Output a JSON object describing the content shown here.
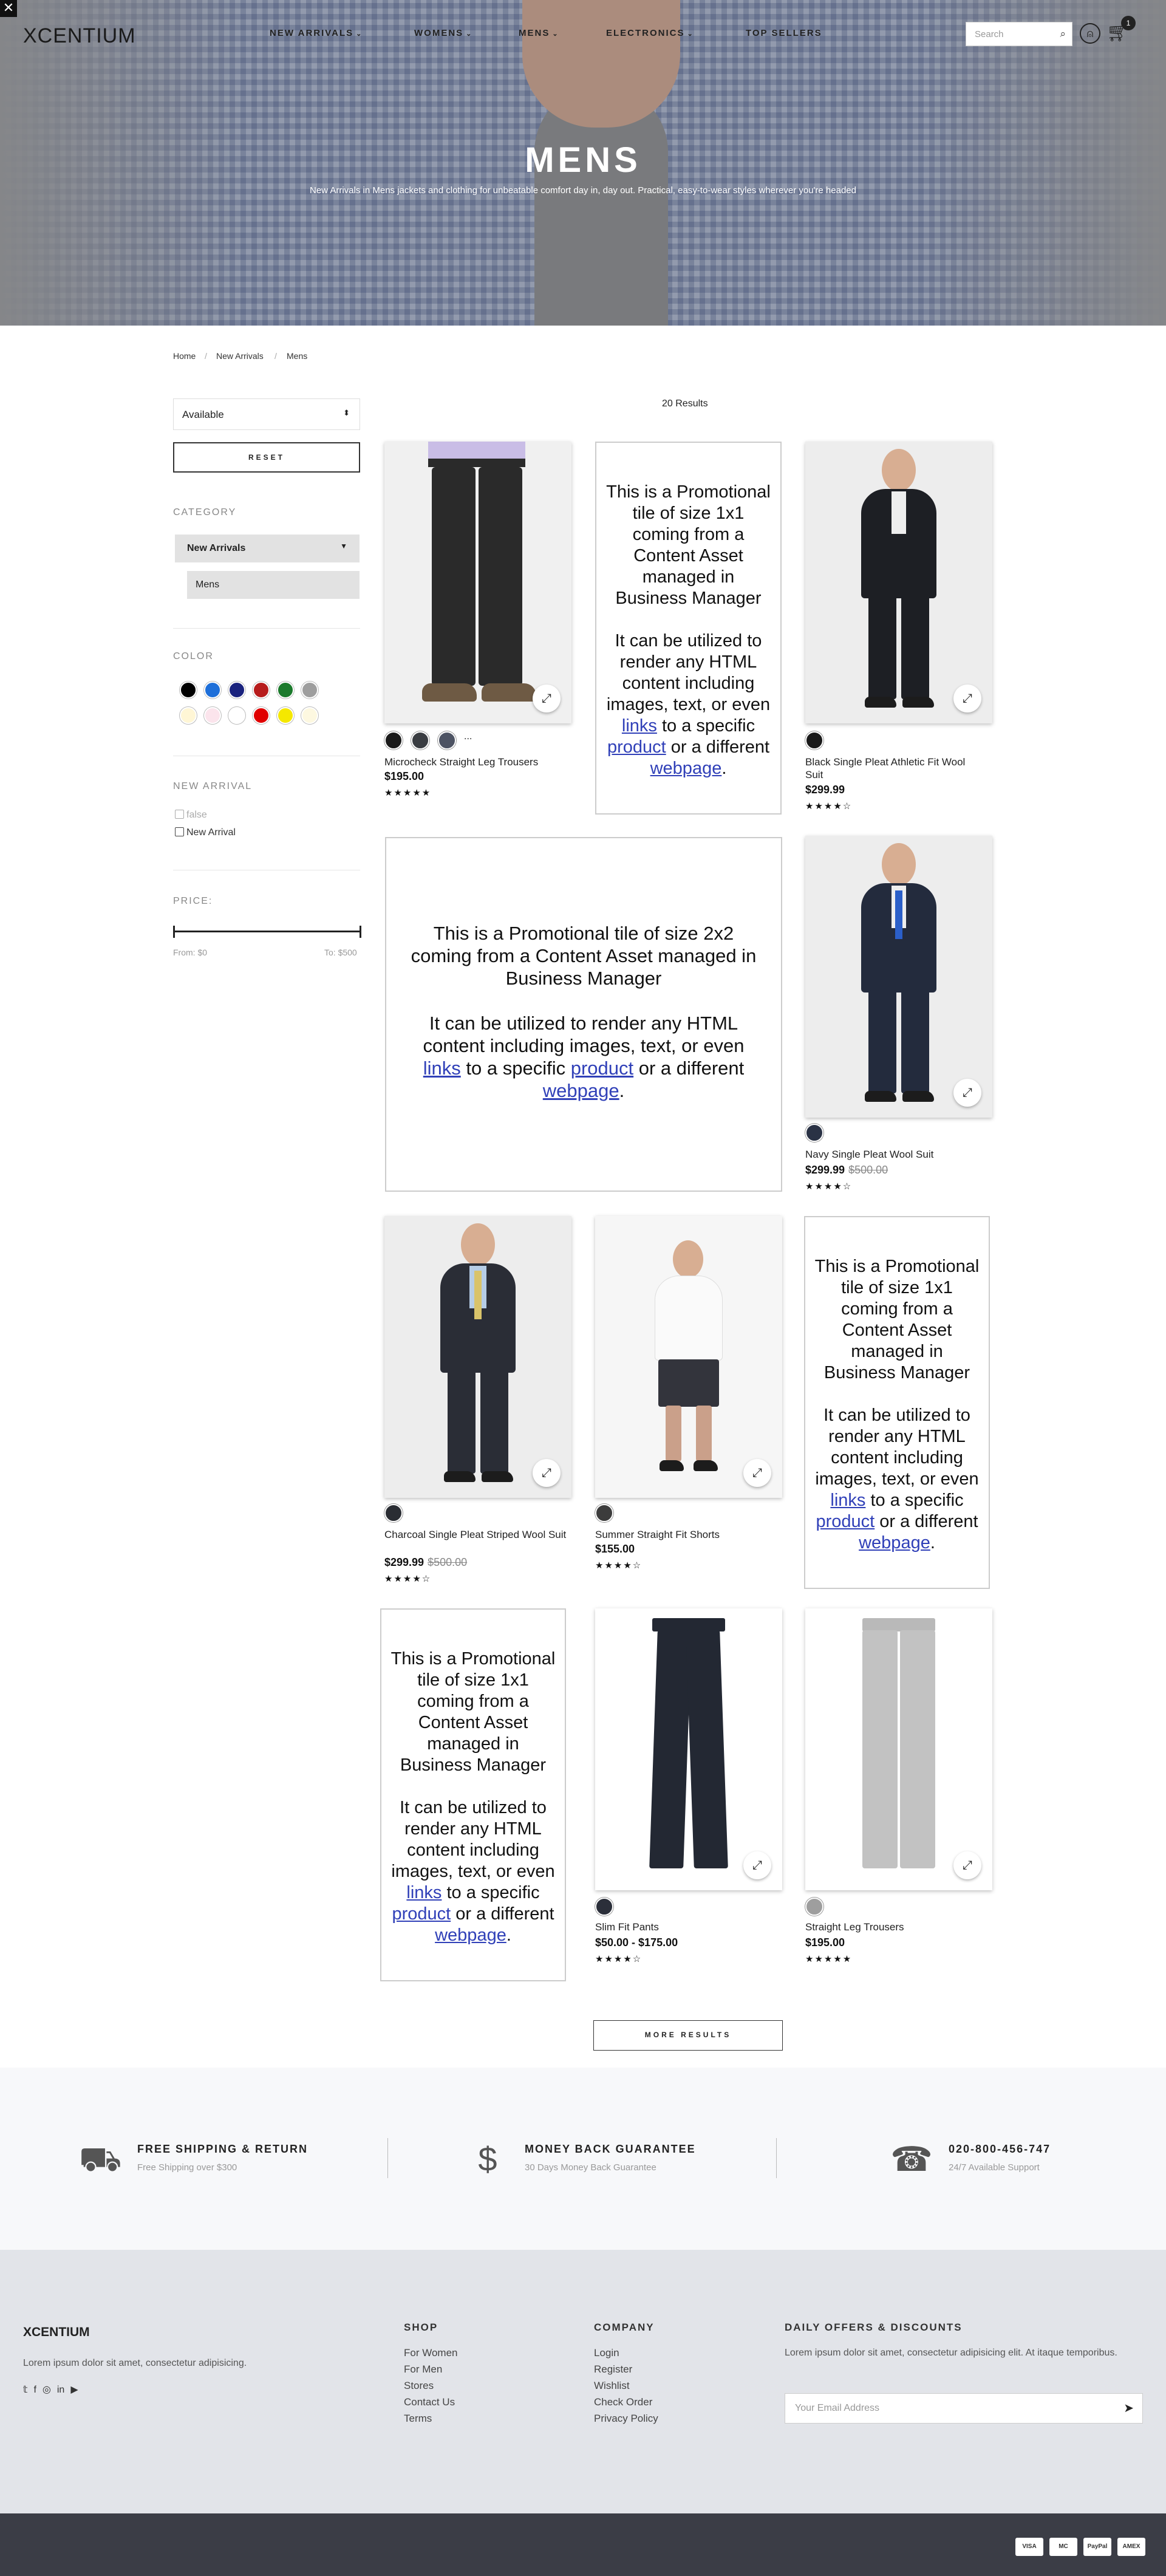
{
  "header": {
    "logo": "XCENTIUM",
    "nav": [
      "NEW ARRIVALS",
      "WOMENS",
      "MENS",
      "ELECTRONICS",
      "TOP SELLERS"
    ],
    "search_placeholder": "Search",
    "cart_count": "1"
  },
  "hero": {
    "title": "MENS",
    "subtitle": "New Arrivals in Mens jackets and clothing for unbeatable comfort day in, day out. Practical, easy-to-wear styles wherever you're headed"
  },
  "breadcrumb": [
    "Home",
    "New Arrivals",
    "Mens"
  ],
  "sidebar": {
    "sort_value": "Available",
    "reset_label": "RESET",
    "category_heading": "CATEGORY",
    "category_selected": "New Arrivals",
    "category_sub": "Mens",
    "color_heading": "COLOR",
    "colors": [
      "#000000",
      "#1e6fd9",
      "#1a237e",
      "#b71c1c",
      "#1b7a2c",
      "#9e9e9e",
      "#fff6d5",
      "#fbe4ec",
      "#ffffff",
      "#e00000",
      "#f5e800",
      "#fdf8e0"
    ],
    "new_arrival_heading": "NEW ARRIVAL",
    "new_arrival_options": [
      "false",
      "New Arrival"
    ],
    "price_heading": "PRICE:",
    "price_from": "From: $0",
    "price_to": "To: $500"
  },
  "results": {
    "count": "20 Results",
    "more_label": "MORE RESULTS"
  },
  "promo": {
    "small_line1": "This is a Promotional tile of size 1x1 coming from a Content Asset managed in Business Manager",
    "large_line1": "This is a Promotional tile of size 2x2 coming  from a Content Asset managed in Business Manager",
    "line2_prefix": "It can be utilized to render any HTML content including images, text, or even",
    "link1": "links",
    "mid1": "to a specific",
    "link2": "product",
    "mid2": "or a different",
    "link3": "webpage",
    "end": "."
  },
  "products": [
    {
      "name": "Microcheck Straight Leg Trousers",
      "price": "$195.00",
      "old_price": "",
      "rating": 4.5,
      "stars": "★★★★★",
      "swatches": [
        "#1a1a1a",
        "#3a3d42",
        "#4d5363"
      ],
      "more": "..."
    },
    {
      "name": "Black Single Pleat Athletic Fit Wool Suit",
      "price": "$299.99",
      "old_price": "",
      "rating": 4,
      "stars": "★★★★☆",
      "swatches": [
        "#1a1a1a"
      ]
    },
    {
      "name": "Navy Single Pleat Wool Suit",
      "price": "$299.99",
      "old_price": "$500.00",
      "rating": 3.5,
      "stars": "★★★★☆",
      "swatches": [
        "#2a3245"
      ]
    },
    {
      "name": "Charcoal Single Pleat Striped Wool Suit",
      "price": "$299.99",
      "old_price": "$500.00",
      "rating": 3.5,
      "stars": "★★★★☆",
      "swatches": [
        "#2a2d33"
      ]
    },
    {
      "name": "Summer Straight Fit Shorts",
      "price": "$155.00",
      "old_price": "",
      "rating": 3.5,
      "stars": "★★★★☆",
      "swatches": [
        "#3c3c3c"
      ]
    },
    {
      "name": "Slim Fit Pants",
      "price": "$50.00 - $175.00",
      "old_price": "",
      "rating": 3.5,
      "stars": "★★★★☆",
      "swatches": [
        "#2b2f3a"
      ]
    },
    {
      "name": "Straight Leg Trousers",
      "price": "$195.00",
      "old_price": "",
      "rating": 5,
      "stars": "★★★★★",
      "swatches": [
        "#9e9e9e"
      ]
    }
  ],
  "features": [
    {
      "title": "FREE SHIPPING & RETURN",
      "subtitle": "Free Shipping over $300",
      "icon": "delivery-truck-icon"
    },
    {
      "title": "MONEY BACK GUARANTEE",
      "subtitle": "30 Days Money Back Guarantee",
      "icon": "money-back-icon"
    },
    {
      "title": "020-800-456-747",
      "subtitle": "24/7 Available Support",
      "icon": "support-agent-icon"
    }
  ],
  "footer": {
    "brand": "XCENTIUM",
    "brand_text": "Lorem ipsum dolor sit amet, consectetur adipisicing.",
    "shop_heading": "SHOP",
    "shop_links": [
      "For Women",
      "For Men",
      "Stores",
      "Contact Us",
      "Terms"
    ],
    "company_heading": "COMPANY",
    "company_links": [
      "Login",
      "Register",
      "Wishlist",
      "Check Order",
      "Privacy Policy"
    ],
    "offers_heading": "DAILY OFFERS & DISCOUNTS",
    "offers_text": "Lorem ipsum dolor sit amet, consectetur adipisicing elit. At itaque temporibus.",
    "email_placeholder": "Your Email Address",
    "payments": [
      "VISA",
      "MC",
      "PayPal",
      "AMEX"
    ]
  },
  "colors": {
    "hero_overlay": "#8f9aaf",
    "footer_bg": "#e2e4e9",
    "bottom_bar": "#3b3d46",
    "link": "#3040b8"
  }
}
